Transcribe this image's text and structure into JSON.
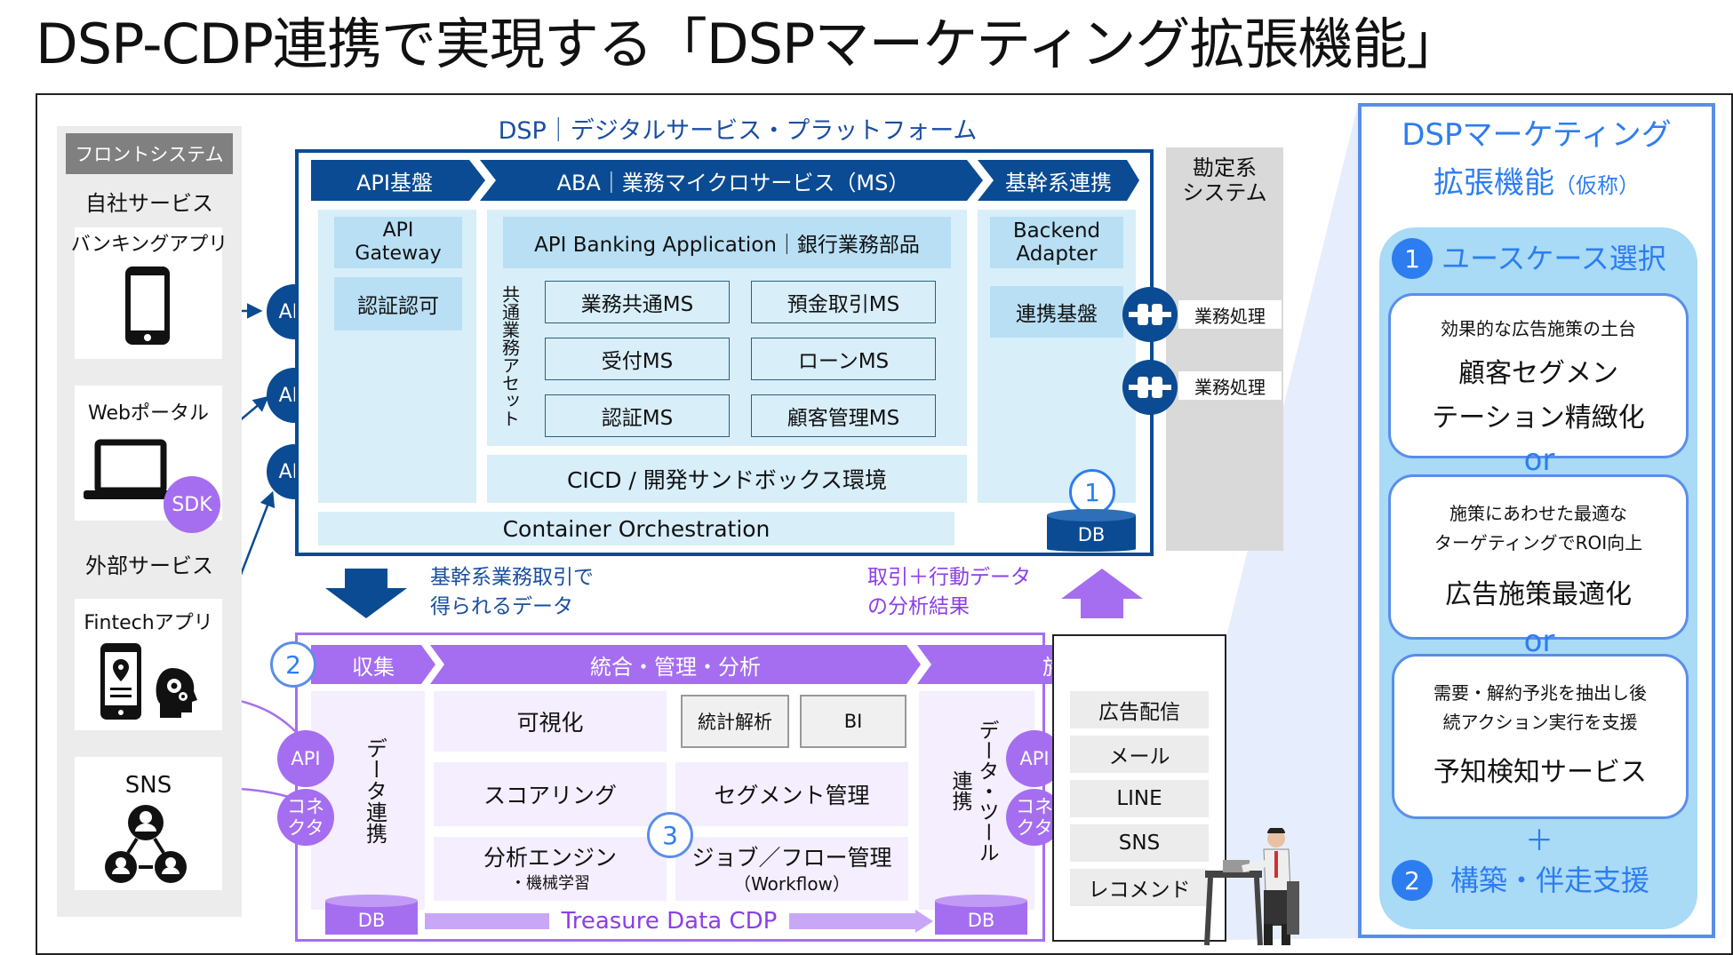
{
  "title": "DSP-CDP連携で実現する「DSPマーケティング拡張機能」",
  "front": {
    "label": "フロントシステム",
    "own_services": "自社サービス",
    "banking_app": "バンキングアプリ",
    "web_portal": "Webポータル",
    "sdk": "SDK",
    "external_services": "外部サービス",
    "fintech_app": "Fintechアプリ",
    "sns": "SNS"
  },
  "api": {
    "label": "API"
  },
  "dsp": {
    "title": "DSP｜デジタルサービス・プラットフォーム",
    "header_api": "API基盤",
    "header_aba": "ABA｜業務マイクロサービス（MS）",
    "header_core": "基幹系連携",
    "api_gateway": "API\nGateway",
    "auth": "認証認可",
    "banking_app": "API Banking Application｜銀行業務部品",
    "common_assets": "共通業務アセット",
    "ms": [
      "業務共通MS",
      "預金取引MS",
      "受付MS",
      "ローンMS",
      "認証MS",
      "顧客管理MS"
    ],
    "cicd": "CICD / 開発サンドボックス環境",
    "container": "Container Orchestration",
    "backend_adapter": "Backend\nAdapter",
    "link_base": "連携基盤",
    "num1": "1",
    "db": "DB"
  },
  "accounting": {
    "title": "勘定系\nシステム",
    "process1": "業務処理",
    "process2": "業務処理"
  },
  "flow": {
    "down_text": "基幹系業務取引で\n得られるデータ",
    "up_text": "取引＋行動データ\nの分析結果"
  },
  "cdp": {
    "num2": "2",
    "header_collect": "収集",
    "header_integrate": "統合・管理・分析",
    "header_policy": "施策",
    "data_link": "データ連携",
    "visualize": "可視化",
    "stats": "統計解析",
    "bi": "BI",
    "scoring": "スコアリング",
    "segment": "セグメント管理",
    "engine": "分析エンジン",
    "engine_sub": "・機械学習",
    "job": "ジョブ／フロー管理",
    "job_sub": "（Workflow）",
    "num3": "3",
    "tool_link": "データ・ツール\n連携",
    "api": "API",
    "connector": "コネ\nクタ",
    "db": "DB",
    "treasure": "Treasure Data CDP"
  },
  "policy_items": [
    "広告配信",
    "メール",
    "LINE",
    "SNS",
    "レコメンド"
  ],
  "right": {
    "title1": "DSPマーケティング",
    "title2": "拡張機能",
    "title2_sub": "（仮称）",
    "num1": "1",
    "usecase": "ユースケース選択",
    "case1_desc": "効果的な広告施策の土台",
    "case1_main": "顧客セグメン\nテーション精緻化",
    "or": "or",
    "case2_desc": "施策にあわせた最適な\nターゲティングでROI向上",
    "case2_main": "広告施策最適化",
    "case3_desc": "需要・解約予兆を抽出し後\n続アクション実行を支援",
    "case3_main": "予知検知サービス",
    "plus": "＋",
    "num2": "2",
    "support": "構築・伴走支援"
  },
  "colors": {
    "navy": "#0b4b93",
    "purple": "#a56ef0",
    "light_blue": "#d8eef9",
    "accent_blue": "#2d7df0"
  }
}
